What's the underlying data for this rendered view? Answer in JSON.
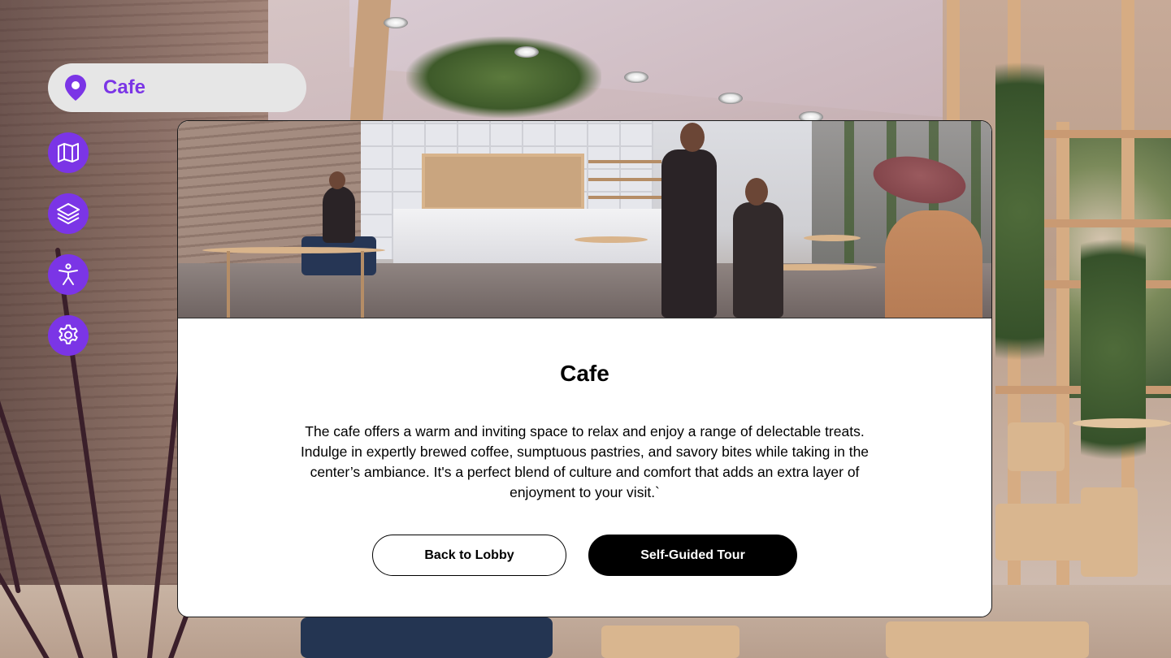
{
  "location": {
    "name": "Cafe",
    "icon": "map-pin-icon"
  },
  "sidebar": {
    "buttons": [
      {
        "icon": "map-icon"
      },
      {
        "icon": "layers-icon"
      },
      {
        "icon": "accessibility-icon"
      },
      {
        "icon": "settings-icon"
      }
    ]
  },
  "card": {
    "title": "Cafe",
    "description": "The cafe offers a warm and inviting space to relax and enjoy a range of delectable treats. Indulge in expertly brewed coffee, sumptuous pastries, and savory bites while taking in the center’s ambiance. It's a perfect blend of culture and comfort that adds an extra layer of enjoyment to your visit.`",
    "buttons": {
      "back_label": "Back to Lobby",
      "tour_label": "Self-Guided Tour"
    }
  },
  "colors": {
    "accent": "#7b35e6",
    "pill_bg": "#e6e6e6",
    "card_bg": "#ffffff",
    "primary_button": "#000000"
  }
}
